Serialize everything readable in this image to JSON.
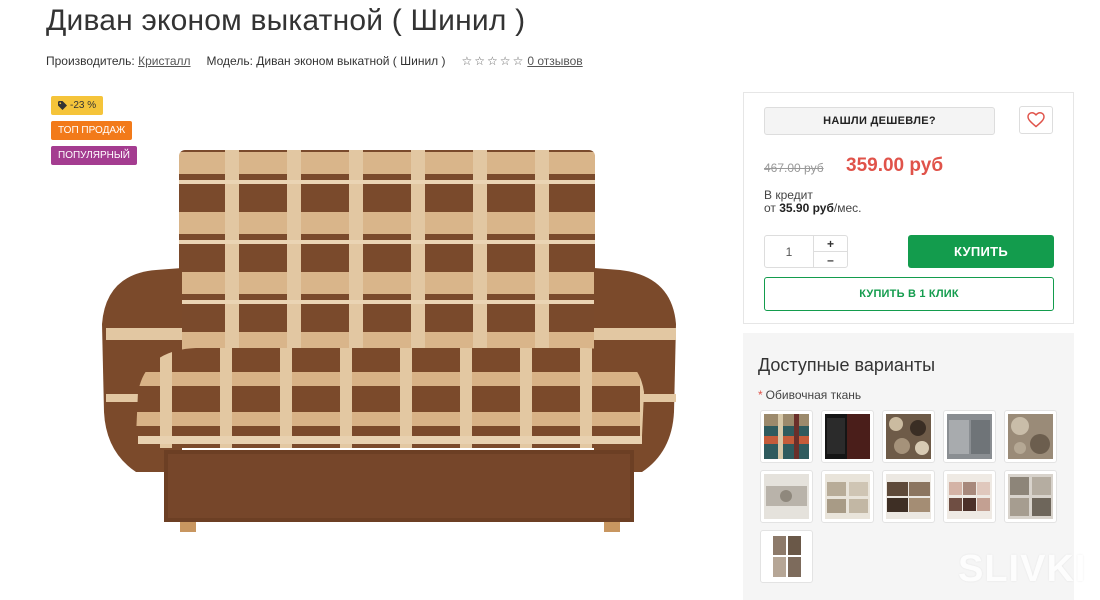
{
  "product": {
    "title": "Диван эконом выкатной ( Шинил )",
    "manufacturer_label": "Производитель:",
    "manufacturer": "Кристалл",
    "model_label": "Модель:",
    "model": "Диван эконом выкатной ( Шинил )",
    "rating_stars": 0,
    "reviews_link": "0 отзывов"
  },
  "badges": {
    "discount": "-23 %",
    "top": "ТОП ПРОДАЖ",
    "popular": "ПОПУЛЯРНЫЙ"
  },
  "buy_box": {
    "cheaper_button": "НАШЛИ ДЕШЕВЛЕ?",
    "old_price": "467.00 руб",
    "new_price": "359.00 руб",
    "credit_line1": "В кредит",
    "credit_prefix": "от",
    "credit_amount": "35.90 руб",
    "credit_suffix": "/мес.",
    "quantity": "1",
    "plus": "+",
    "minus": "–",
    "buy_button": "КУПИТЬ",
    "one_click_button": "КУПИТЬ В 1 КЛИК"
  },
  "variants": {
    "title": "Доступные варианты",
    "required_mark": "*",
    "option_label": "Обивочная ткань",
    "swatch_count": 11
  },
  "watermark": "SLIVKI",
  "colors": {
    "accent_green": "#139c4d",
    "price_red": "#e0534a",
    "badge_yellow": "#f5c43a",
    "badge_orange": "#f27a1a",
    "badge_purple": "#a43c90"
  },
  "icons": [
    "tag-icon",
    "heart-icon",
    "star-icon"
  ]
}
